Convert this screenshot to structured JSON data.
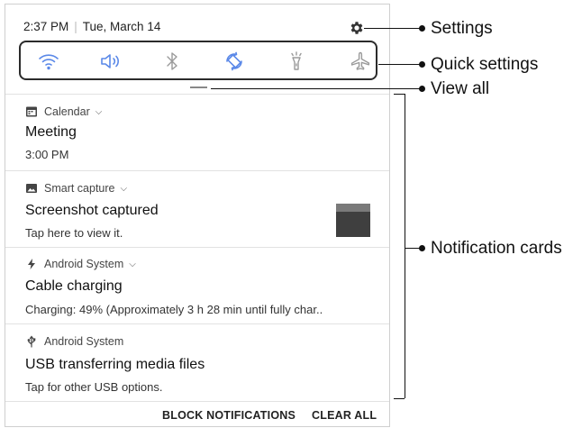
{
  "status": {
    "time": "2:37 PM",
    "date": "Tue, March 14"
  },
  "quick_settings": [
    "wifi-icon",
    "sound-icon",
    "bluetooth-icon",
    "auto-rotate-icon",
    "flashlight-icon",
    "airplane-mode-icon"
  ],
  "notifications": [
    {
      "app": "Calendar",
      "title": "Meeting",
      "text": "3:00 PM",
      "icon": "calendar-icon",
      "expandable": true
    },
    {
      "app": "Smart capture",
      "title": "Screenshot captured",
      "text": "Tap here to view it.",
      "icon": "image-icon",
      "expandable": true
    },
    {
      "app": "Android System",
      "title": "Cable charging",
      "text": "Charging: 49% (Approximately 3 h 28 min until fully char..",
      "icon": "bolt-icon",
      "expandable": true
    },
    {
      "app": "Android System",
      "title": "USB transferring media files",
      "text": "Tap for other USB options.",
      "icon": "usb-icon",
      "expandable": false
    }
  ],
  "actions": {
    "block": "BLOCK NOTIFICATIONS",
    "clear": "CLEAR ALL"
  },
  "callouts": {
    "settings": "Settings",
    "quick_settings": "Quick settings",
    "view_all": "View all",
    "notification_cards": "Notification cards"
  },
  "colors": {
    "quick_settings_icon": "#5a88e8",
    "quick_settings_inactive": "#9a9a9a"
  }
}
